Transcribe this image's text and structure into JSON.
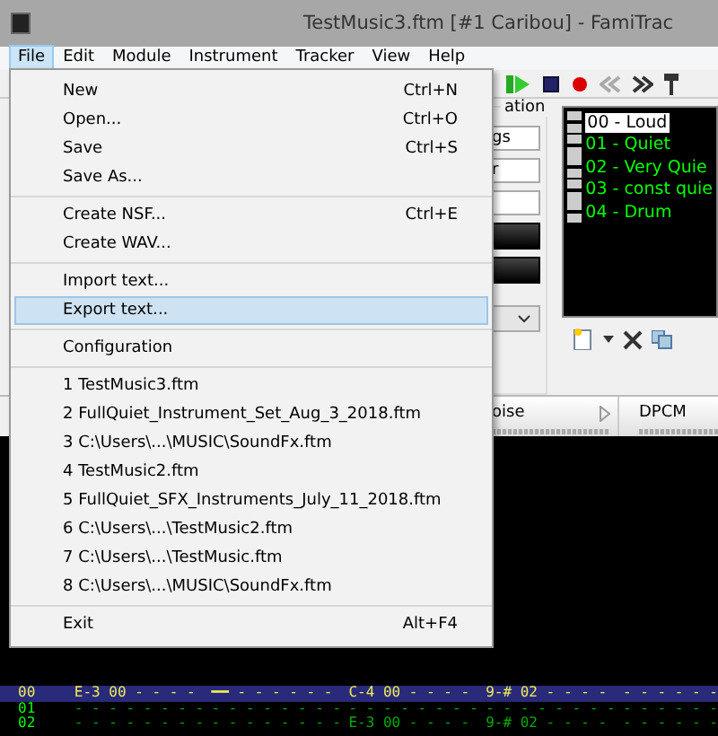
{
  "window": {
    "title": "TestMusic3.ftm [#1 Caribou] - FamiTrac"
  },
  "menu_bar": [
    {
      "label": "File",
      "selected": true
    },
    {
      "label": "Edit",
      "selected": false
    },
    {
      "label": "Module",
      "selected": false
    },
    {
      "label": "Instrument",
      "selected": false
    },
    {
      "label": "Tracker",
      "selected": false
    },
    {
      "label": "View",
      "selected": false
    },
    {
      "label": "Help",
      "selected": false
    }
  ],
  "file_menu": [
    [
      {
        "label": "New",
        "shortcut": "Ctrl+N",
        "highlighted": false
      },
      {
        "label": "Open...",
        "shortcut": "Ctrl+O",
        "highlighted": false
      },
      {
        "label": "Save",
        "shortcut": "Ctrl+S",
        "highlighted": false
      },
      {
        "label": "Save As...",
        "highlighted": false
      }
    ],
    [
      {
        "label": "Create NSF...",
        "shortcut": "Ctrl+E",
        "highlighted": false
      },
      {
        "label": "Create WAV...",
        "highlighted": false
      }
    ],
    [
      {
        "label": "Import text...",
        "highlighted": false
      },
      {
        "label": "Export text...",
        "highlighted": true
      }
    ],
    [
      {
        "label": "Configuration",
        "highlighted": false
      }
    ],
    [
      {
        "label": "1 TestMusic3.ftm",
        "highlighted": false
      },
      {
        "label": "2 FullQuiet_Instrument_Set_Aug_3_2018.ftm",
        "highlighted": false
      },
      {
        "label": "3 C:\\Users\\...\\MUSIC\\SoundFx.ftm",
        "highlighted": false
      },
      {
        "label": "4 TestMusic2.ftm",
        "highlighted": false
      },
      {
        "label": "5 FullQuiet_SFX_Instruments_July_11_2018.ftm",
        "highlighted": false
      },
      {
        "label": "6 C:\\Users\\...\\TestMusic2.ftm",
        "highlighted": false
      },
      {
        "label": "7 C:\\Users\\...\\TestMusic.ftm",
        "highlighted": false
      },
      {
        "label": "8 C:\\Users\\...\\MUSIC\\SoundFx.ftm",
        "highlighted": false
      }
    ],
    [
      {
        "label": "Exit",
        "shortcut": "Alt+F4",
        "highlighted": false
      }
    ]
  ],
  "song_panel": {
    "group_title": "ation",
    "fields": [
      "gs",
      "r"
    ]
  },
  "instruments": [
    {
      "label": "00 - Loud",
      "selected": true
    },
    {
      "label": "01 - Quiet",
      "selected": false
    },
    {
      "label": "02 - Very Quie",
      "selected": false
    },
    {
      "label": "03 - const quie",
      "selected": false
    },
    {
      "label": "04 - Drum",
      "selected": false
    }
  ],
  "channels": [
    "oise",
    "DPCM"
  ],
  "pattern": {
    "rows": [
      {
        "number": "00",
        "selected": true,
        "cells": [
          "E-3 00 - - - -",
          "━━ - - - - - -",
          "C-4 00 - - - -",
          "9-# 02 - - - -",
          "- - - - - -"
        ]
      },
      {
        "number": "01",
        "selected": false,
        "cells": [
          "- - - - - - - -",
          "- - - - - - - -",
          "- - - - - - - -",
          "- - - - - - - -",
          "- - - - - -"
        ]
      },
      {
        "number": "02",
        "selected": false,
        "cells": [
          "- - - - - - - -",
          "- - - - - - - -",
          "E-3 00 - - - -",
          "9-# 02 - - - -",
          "- - - - - -"
        ]
      }
    ]
  }
}
